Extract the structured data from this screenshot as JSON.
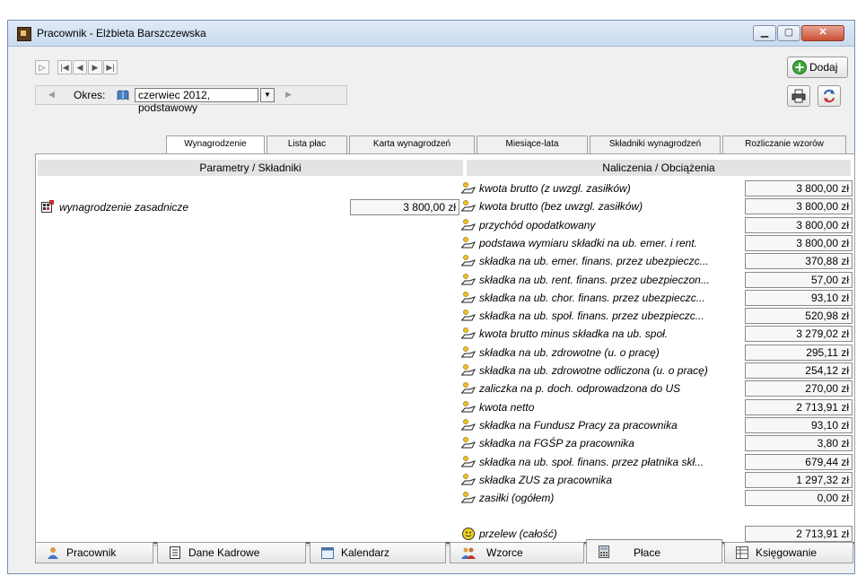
{
  "window": {
    "title": "Pracownik - Elżbieta Barszczewska"
  },
  "toolbar": {
    "period_label": "Okres:",
    "period_value": "czerwiec 2012, podstawowy",
    "add_label": "Dodaj"
  },
  "tabs_top": [
    {
      "label": "Wynagrodzenie",
      "active": true
    },
    {
      "label": "Lista płac"
    },
    {
      "label": "Karta wynagrodzeń"
    },
    {
      "label": "Miesiące-lata"
    },
    {
      "label": "Składniki wynagrodzeń"
    },
    {
      "label": "Rozliczanie wzorów"
    }
  ],
  "headers": {
    "left": "Parametry / Składniki",
    "right": "Naliczenia / Obciążenia"
  },
  "left_item": {
    "name": "wynagrodzenie zasadnicze",
    "value": "3 800,00 zł"
  },
  "rows": [
    {
      "name": "kwota brutto (z uwzgl. zasiłków)",
      "value": "3 800,00 zł"
    },
    {
      "name": "kwota brutto (bez uwzgl. zasiłków)",
      "value": "3 800,00 zł"
    },
    {
      "name": "przychód opodatkowany",
      "value": "3 800,00 zł"
    },
    {
      "name": "podstawa wymiaru składki na ub. emer. i rent.",
      "value": "3 800,00 zł"
    },
    {
      "name": "składka na ub. emer. finans. przez ubezpieczc...",
      "value": "370,88 zł"
    },
    {
      "name": "składka na ub. rent. finans. przez ubezpieczon...",
      "value": "57,00 zł"
    },
    {
      "name": "składka na ub. chor. finans. przez ubezpieczc...",
      "value": "93,10 zł"
    },
    {
      "name": "składka na ub. społ. finans. przez ubezpieczc...",
      "value": "520,98 zł"
    },
    {
      "name": "kwota brutto minus składka na ub. społ.",
      "value": "3 279,02 zł"
    },
    {
      "name": "składka na ub. zdrowotne (u. o pracę)",
      "value": "295,11 zł"
    },
    {
      "name": "składka na ub. zdrowotne odliczona (u. o pracę)",
      "value": "254,12 zł"
    },
    {
      "name": "zaliczka na p. doch. odprowadzona do US",
      "value": "270,00 zł"
    },
    {
      "name": "kwota netto",
      "value": "2 713,91 zł"
    },
    {
      "name": "składka na Fundusz Pracy za pracownika",
      "value": "93,10 zł"
    },
    {
      "name": "składka na FGŚP za pracownika",
      "value": "3,80 zł"
    },
    {
      "name": "składka na ub. społ. finans. przez płatnika skł...",
      "value": "679,44 zł"
    },
    {
      "name": "składka ZUS za pracownika",
      "value": "1 297,32 zł"
    },
    {
      "name": "zasiłki (ogółem)",
      "value": "0,00 zł"
    }
  ],
  "transfer": {
    "name": "przelew (całość)",
    "value": "2 713,91 zł"
  },
  "tabs_bottom": [
    {
      "label": "Pracownik",
      "icon": "person-icon"
    },
    {
      "label": "Dane Kadrowe",
      "icon": "document-icon"
    },
    {
      "label": "Kalendarz",
      "icon": "calendar-icon"
    },
    {
      "label": "Wzorce",
      "icon": "people-icon"
    },
    {
      "label": "Płace",
      "icon": "calculator-icon",
      "active": true
    },
    {
      "label": "Księgowanie",
      "icon": "ledger-icon"
    }
  ]
}
